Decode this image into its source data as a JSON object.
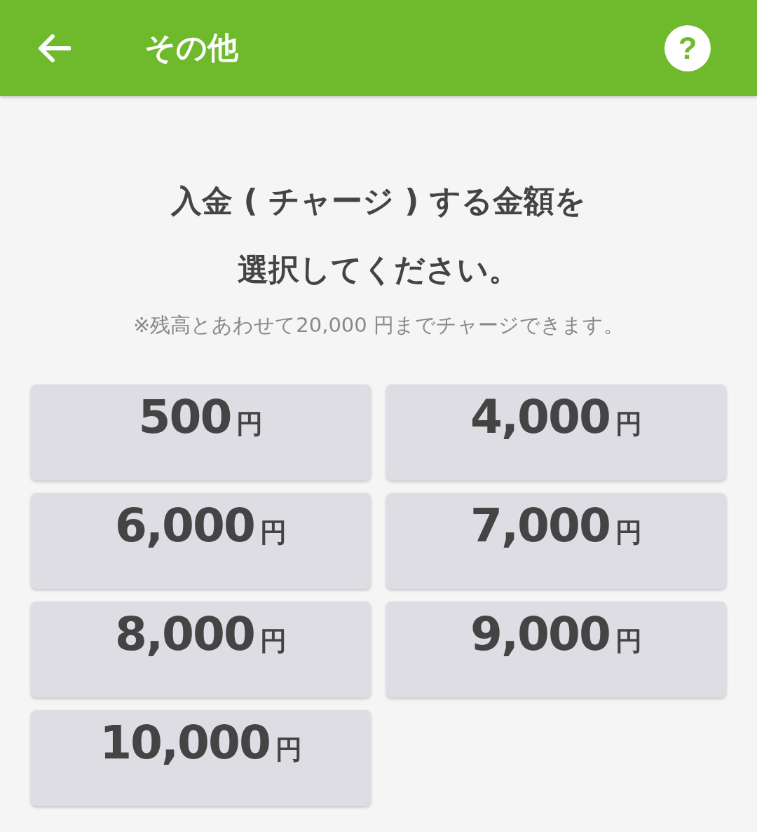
{
  "header": {
    "title": "その他",
    "help_label": "?"
  },
  "prompt": {
    "lines": [
      "入金 ( チャージ ) する金額を",
      "選択してください。"
    ],
    "note": "※残高とあわせて20,000 円までチャージできます。"
  },
  "amounts": [
    {
      "amount": "500",
      "unit": "円"
    },
    {
      "amount": "4,000",
      "unit": "円"
    },
    {
      "amount": "6,000",
      "unit": "円"
    },
    {
      "amount": "7,000",
      "unit": "円"
    },
    {
      "amount": "8,000",
      "unit": "円"
    },
    {
      "amount": "9,000",
      "unit": "円"
    },
    {
      "amount": "10,000",
      "unit": "円"
    }
  ]
}
